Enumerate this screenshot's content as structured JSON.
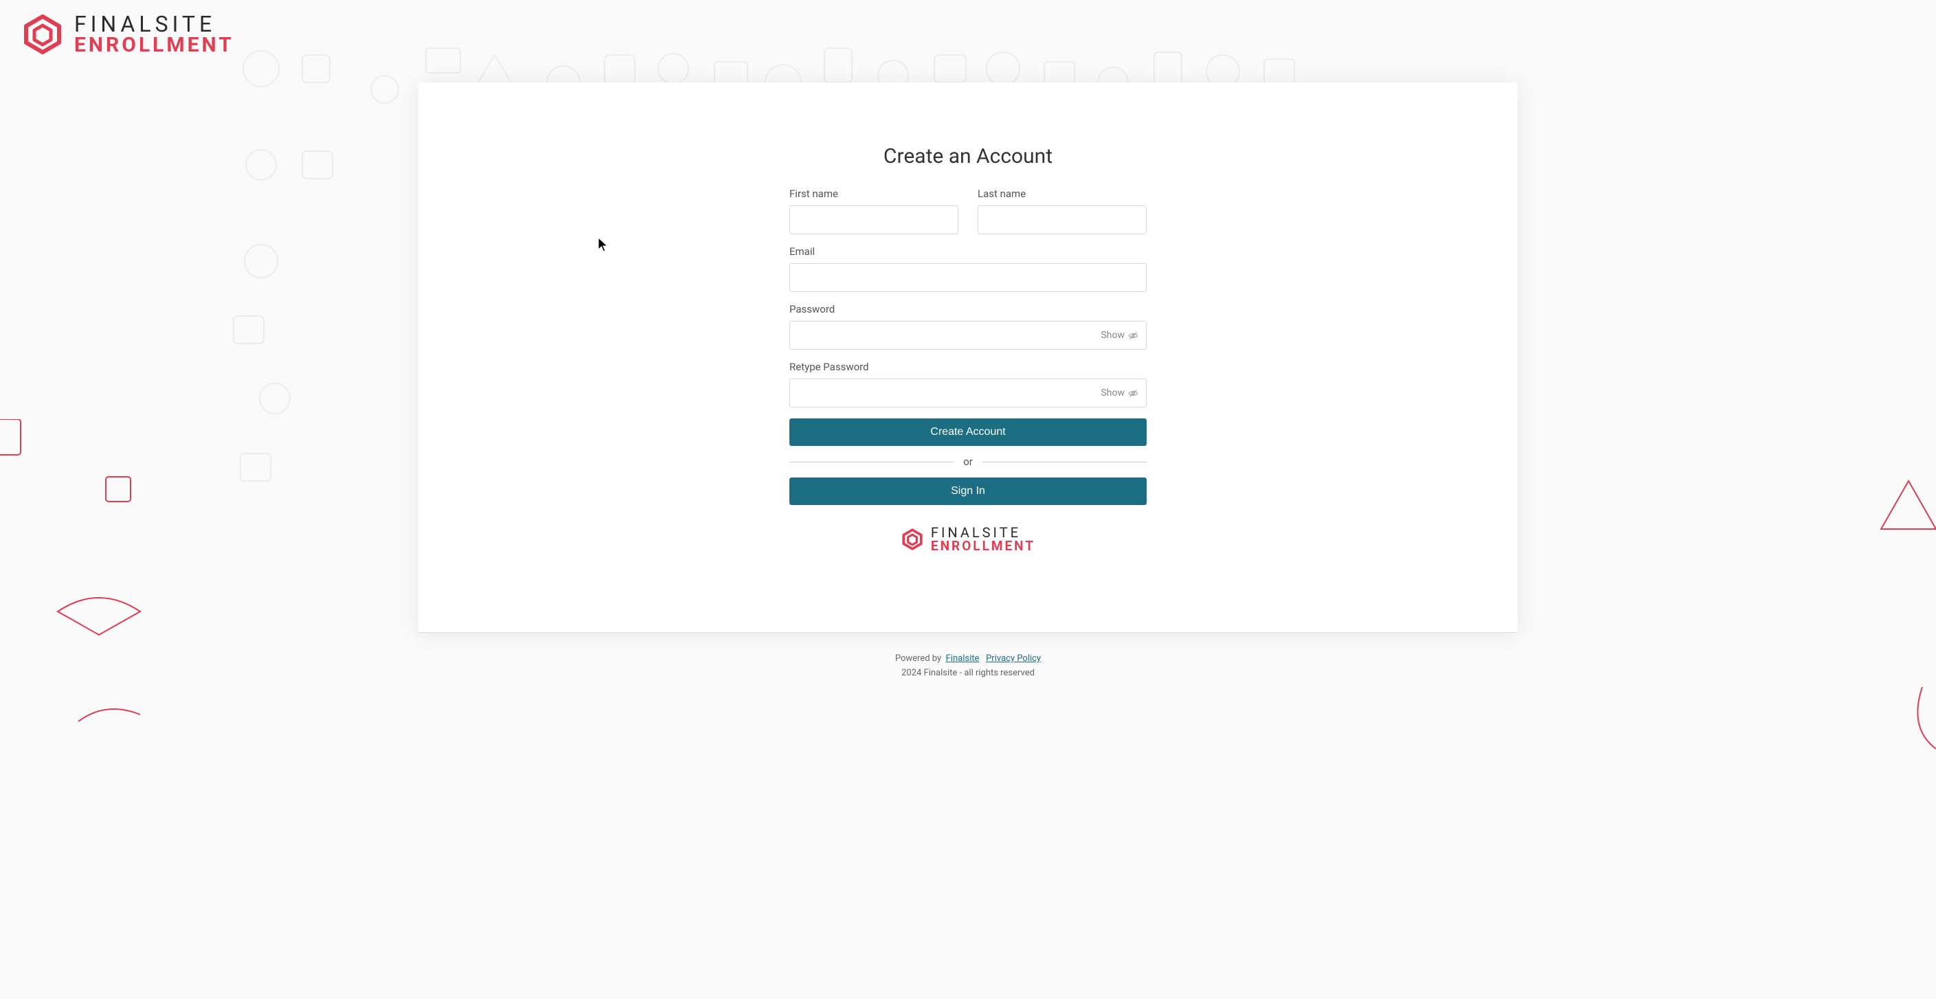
{
  "brand": {
    "top": "FINALSITE",
    "bottom": "ENROLLMENT"
  },
  "page": {
    "title": "Create an Account"
  },
  "form": {
    "first_name_label": "First name",
    "first_name_value": "",
    "last_name_label": "Last name",
    "last_name_value": "",
    "email_label": "Email",
    "email_value": "",
    "password_label": "Password",
    "password_value": "",
    "retype_label": "Retype Password",
    "retype_value": "",
    "show_text": "Show",
    "create_btn": "Create Account",
    "divider": "or",
    "signin_btn": "Sign In"
  },
  "footer": {
    "powered_by": "Powered by",
    "finalsite_link": "Finalsite",
    "privacy_link": "Privacy Policy",
    "copyright": "2024 Finalsite - all rights reserved"
  }
}
